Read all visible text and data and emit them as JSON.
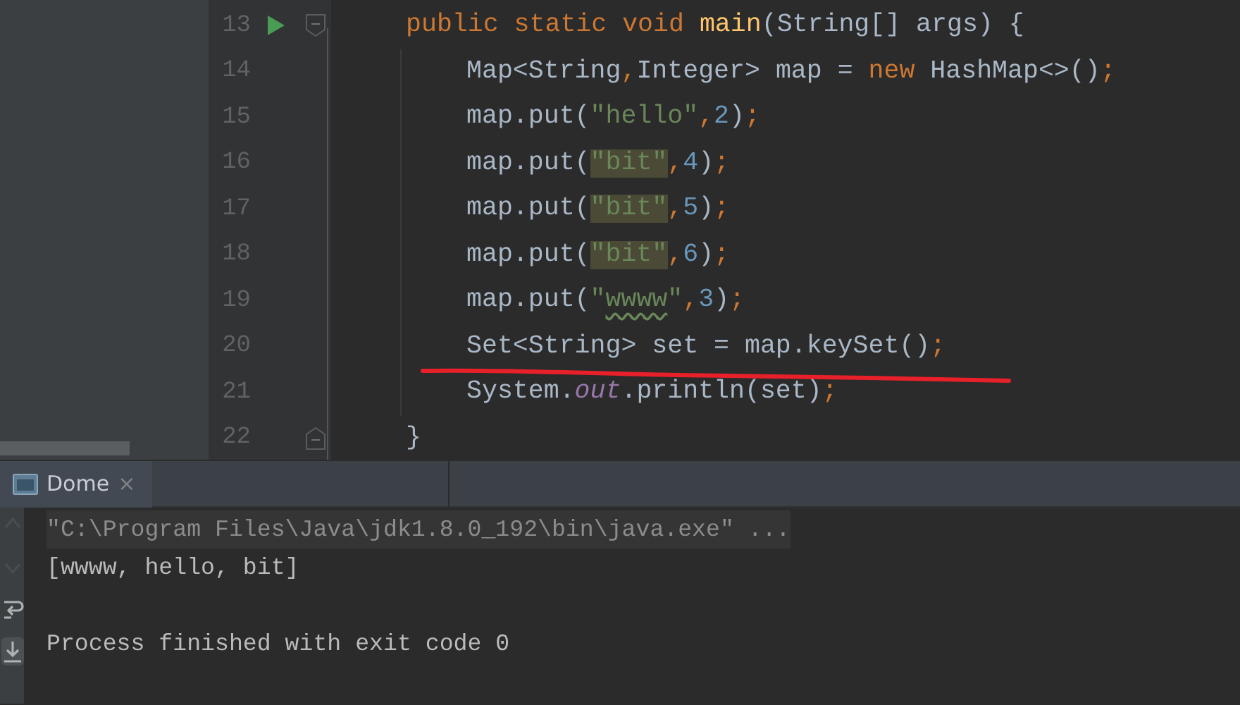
{
  "editor": {
    "lines": [
      {
        "number": "13",
        "markers": [
          {
            "kind": "run"
          },
          {
            "kind": "fold-start"
          }
        ],
        "tokens": [
          {
            "text": "public static void ",
            "kind": "keyword"
          },
          {
            "text": "main",
            "kind": "method"
          },
          {
            "text": "(String[] args) {",
            "kind": "plain"
          }
        ],
        "children": [
          {
            "number": "14",
            "tokens": [
              {
                "text": "Map<String",
                "kind": "plain"
              },
              {
                "text": ",",
                "kind": "punct"
              },
              {
                "text": "Integer> map = ",
                "kind": "plain"
              },
              {
                "text": "new",
                "kind": "keyword"
              },
              {
                "text": " HashMap<>()",
                "kind": "plain"
              },
              {
                "text": ";",
                "kind": "punct"
              }
            ]
          },
          {
            "number": "15",
            "tokens": [
              {
                "text": "map.put(",
                "kind": "plain"
              },
              {
                "text": "\"hello\"",
                "kind": "string"
              },
              {
                "text": ",",
                "kind": "punct"
              },
              {
                "text": "2",
                "kind": "number"
              },
              {
                "text": ")",
                "kind": "plain"
              },
              {
                "text": ";",
                "kind": "punct"
              }
            ]
          },
          {
            "number": "16",
            "tokens": [
              {
                "text": "map.put(",
                "kind": "plain"
              },
              {
                "text": "\"bit\"",
                "kind": "string-match"
              },
              {
                "text": ",",
                "kind": "punct"
              },
              {
                "text": "4",
                "kind": "number"
              },
              {
                "text": ")",
                "kind": "plain"
              },
              {
                "text": ";",
                "kind": "punct"
              }
            ]
          },
          {
            "number": "17",
            "tokens": [
              {
                "text": "map.put(",
                "kind": "plain"
              },
              {
                "text": "\"bit\"",
                "kind": "string-match"
              },
              {
                "text": ",",
                "kind": "punct"
              },
              {
                "text": "5",
                "kind": "number"
              },
              {
                "text": ")",
                "kind": "plain"
              },
              {
                "text": ";",
                "kind": "punct"
              }
            ]
          },
          {
            "number": "18",
            "tokens": [
              {
                "text": "map.put(",
                "kind": "plain"
              },
              {
                "text": "\"bit\"",
                "kind": "string-match"
              },
              {
                "text": ",",
                "kind": "punct"
              },
              {
                "text": "6",
                "kind": "number"
              },
              {
                "text": ")",
                "kind": "plain"
              },
              {
                "text": ";",
                "kind": "punct"
              }
            ]
          },
          {
            "number": "19",
            "tokens": [
              {
                "text": "map.put(",
                "kind": "plain"
              },
              {
                "text": "\"",
                "kind": "string"
              },
              {
                "text": "wwww",
                "kind": "string-typo"
              },
              {
                "text": "\"",
                "kind": "string"
              },
              {
                "text": ",",
                "kind": "punct"
              },
              {
                "text": "3",
                "kind": "number"
              },
              {
                "text": ")",
                "kind": "plain"
              },
              {
                "text": ";",
                "kind": "punct"
              }
            ]
          },
          {
            "number": "20",
            "tokens": [
              {
                "text": "Set<String> set = map.keySet()",
                "kind": "plain"
              },
              {
                "text": ";",
                "kind": "punct"
              }
            ]
          },
          {
            "number": "21",
            "tokens": [
              {
                "text": "System.",
                "kind": "plain"
              },
              {
                "text": "out",
                "kind": "field"
              },
              {
                "text": ".println(set)",
                "kind": "plain"
              },
              {
                "text": ";",
                "kind": "punct"
              }
            ]
          }
        ]
      },
      {
        "number": "22",
        "markers": [
          {
            "kind": "fold-end"
          }
        ],
        "tokens": [
          {
            "text": "}",
            "kind": "plain"
          }
        ]
      }
    ],
    "annotation": {
      "kind": "underline"
    }
  },
  "run_panel": {
    "tabs": [
      {
        "label": "Dome",
        "close": "×",
        "selected": true
      }
    ],
    "toolbar": [
      {
        "kind": "up",
        "disabled": true,
        "selected": false
      },
      {
        "kind": "down",
        "disabled": true,
        "selected": false
      },
      {
        "kind": "wrap",
        "disabled": false,
        "selected": false
      },
      {
        "kind": "scroll-end",
        "disabled": false,
        "selected": true
      }
    ],
    "console": [
      {
        "kind": "command",
        "text": "\"C:\\Program Files\\Java\\jdk1.8.0_192\\bin\\java.exe\" ..."
      },
      {
        "kind": "output",
        "text": "[wwww, hello, bit]"
      },
      {
        "kind": "status",
        "text": "Process finished with exit code 0"
      }
    ]
  }
}
